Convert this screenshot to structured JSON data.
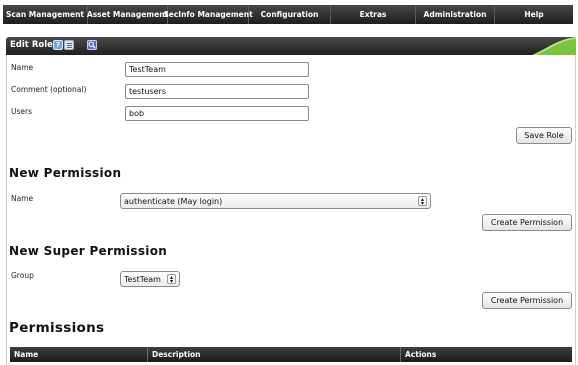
{
  "menu": {
    "items": [
      {
        "label": "Scan Management"
      },
      {
        "label": "Asset Management"
      },
      {
        "label": "SecInfo Management"
      },
      {
        "label": "Configuration"
      },
      {
        "label": "Extras"
      },
      {
        "label": "Administration"
      },
      {
        "label": "Help"
      }
    ]
  },
  "header": {
    "title": "Edit Role",
    "help_icon_glyph": "?",
    "icons": [
      "help-icon",
      "list-icon",
      "search-icon"
    ],
    "accent_color": "#7cc53a"
  },
  "form": {
    "name_label": "Name",
    "name_value": "TestTeam",
    "comment_label": "Comment (optional)",
    "comment_value": "testusers",
    "users_label": "Users",
    "users_value": "bob",
    "save_label": "Save Role"
  },
  "new_permission": {
    "heading": "New Permission",
    "name_label": "Name",
    "selected": "authenticate (May login)",
    "create_label": "Create Permission"
  },
  "new_super_permission": {
    "heading": "New Super Permission",
    "group_label": "Group",
    "selected": "TestTeam",
    "create_label": "Create Permission"
  },
  "permissions": {
    "heading": "Permissions",
    "columns": [
      "Name",
      "Description",
      "Actions"
    ]
  }
}
